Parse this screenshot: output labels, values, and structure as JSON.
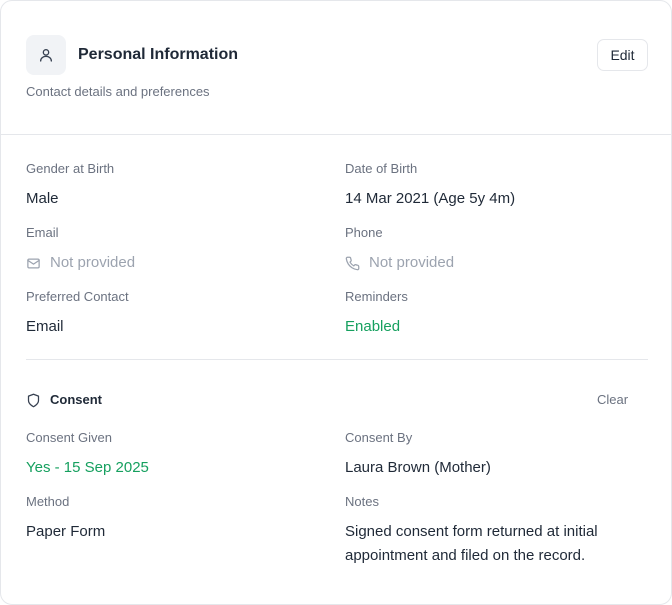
{
  "header": {
    "title": "Personal Information",
    "subtitle": "Contact details and preferences",
    "edit_label": "Edit",
    "avatar_icon": "user-icon"
  },
  "fields": {
    "gender": {
      "label": "Gender at Birth",
      "value": "Male"
    },
    "dob": {
      "label": "Date of Birth",
      "value": "14 Mar 2021 (Age 5y 4m)"
    },
    "email": {
      "label": "Email",
      "value": "Not provided",
      "icon": "mail-icon"
    },
    "phone": {
      "label": "Phone",
      "value": "Not provided",
      "icon": "phone-icon"
    },
    "preferred_contact": {
      "label": "Preferred Contact",
      "value": "Email"
    },
    "reminders": {
      "label": "Reminders",
      "value": "Enabled"
    }
  },
  "consent": {
    "title": "Consent",
    "icon": "shield-icon",
    "clear_label": "Clear",
    "given": {
      "label": "Consent Given",
      "value": "Yes - 15 Sep 2025"
    },
    "by": {
      "label": "Consent By",
      "value": "Laura Brown (Mother)"
    },
    "method": {
      "label": "Method",
      "value": "Paper Form"
    },
    "notes": {
      "label": "Notes",
      "value": "Signed consent form returned at initial appointment and filed on the record."
    }
  },
  "colors": {
    "accent_green": "#16a05f",
    "muted": "#9ca3af",
    "label": "#6b7280",
    "border": "#e5e7eb"
  }
}
